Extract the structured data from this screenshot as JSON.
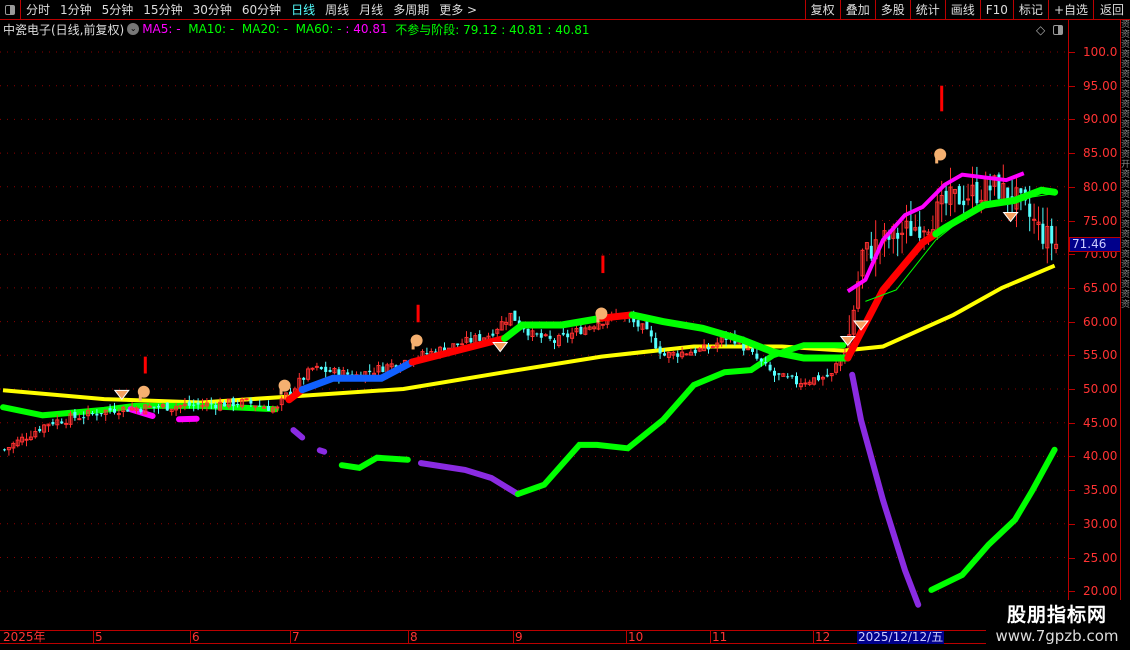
{
  "toolbar": {
    "periods": [
      "分时",
      "1分钟",
      "5分钟",
      "15分钟",
      "30分钟",
      "60分钟",
      "日线",
      "周线",
      "月线",
      "多周期",
      "更多 >"
    ],
    "active": "日线",
    "tools": [
      "复权",
      "叠加",
      "多股",
      "统计",
      "画线",
      "F10",
      "标记",
      "+自选"
    ],
    "back": "返回"
  },
  "legend": {
    "title": "中瓷电子(日线,前复权)",
    "ma5": "MA5: -",
    "ma10": "MA10: -",
    "ma20": "MA20: -",
    "ma60": "MA60: -",
    "ma_val": ": 40.81",
    "stage": "不参与阶段: 79.12 : 40.81 : 40.81"
  },
  "axis": {
    "ticks": [
      "100.0",
      "95.00",
      "90.00",
      "85.00",
      "80.00",
      "75.00",
      "70.00",
      "65.00",
      "60.00",
      "55.00",
      "50.00",
      "45.00",
      "40.00",
      "35.00",
      "30.00",
      "25.00",
      "20.00"
    ],
    "current_price": "71.46"
  },
  "dates": {
    "labels": [
      "2025年",
      "5",
      "6",
      "7",
      "8",
      "9",
      "10",
      "11",
      "12"
    ],
    "current": "2025/12/12/五"
  },
  "watermark": {
    "line1": "股朋指标网",
    "line2": "www.7gpzb.com"
  },
  "side_strip": "资资资资资资资资资资资资资资开资资资资资资资资资资资资资资",
  "colors": {
    "up": "#ff3030",
    "down": "#54ffff",
    "ma_yellow": "#ffff00",
    "green": "#00ff00",
    "purple": "#8a2be2",
    "magenta": "#ff00ff",
    "red": "#ff0000",
    "blue": "#1060ff"
  },
  "chart_data": {
    "type": "candlestick",
    "ylim": [
      17,
      103
    ],
    "days": 240,
    "close_path": [
      [
        0,
        41
      ],
      [
        10,
        45
      ],
      [
        25,
        47
      ],
      [
        40,
        47.5
      ],
      [
        55,
        48
      ],
      [
        62,
        47
      ],
      [
        64,
        49
      ],
      [
        70,
        53
      ],
      [
        80,
        52
      ],
      [
        90,
        54
      ],
      [
        100,
        56
      ],
      [
        110,
        58
      ],
      [
        115,
        61
      ],
      [
        120,
        58
      ],
      [
        125,
        57
      ],
      [
        135,
        60
      ],
      [
        140,
        61
      ],
      [
        145,
        59
      ],
      [
        150,
        55
      ],
      [
        160,
        56
      ],
      [
        165,
        58
      ],
      [
        170,
        55
      ],
      [
        175,
        52
      ],
      [
        180,
        51
      ],
      [
        188,
        52
      ],
      [
        192,
        58
      ],
      [
        195,
        70
      ],
      [
        200,
        72
      ],
      [
        210,
        75
      ],
      [
        215,
        78
      ],
      [
        225,
        80
      ],
      [
        230,
        78
      ],
      [
        236,
        73
      ],
      [
        239,
        71.46
      ]
    ],
    "yellow_ma": [
      [
        0,
        49.8
      ],
      [
        23,
        48.5
      ],
      [
        45,
        48.0
      ],
      [
        68,
        49.0
      ],
      [
        91,
        50.0
      ],
      [
        114,
        52.5
      ],
      [
        136,
        54.8
      ],
      [
        157,
        56.3
      ],
      [
        177,
        56.3
      ],
      [
        191,
        55.7
      ],
      [
        200,
        56.3
      ],
      [
        216,
        61.0
      ],
      [
        227,
        65.0
      ],
      [
        239,
        68.3
      ]
    ],
    "lower_segments": [
      {
        "c": "green",
        "p": [
          [
            0,
            47.3
          ],
          [
            9,
            46.1
          ],
          [
            23,
            46.9
          ],
          [
            30,
            47.5
          ],
          [
            45,
            47.5
          ],
          [
            62,
            47.0
          ]
        ]
      },
      {
        "c": "magenta",
        "p": [
          [
            29,
            47.0
          ],
          [
            34,
            46.0
          ]
        ]
      },
      {
        "c": "magenta",
        "p": [
          [
            40,
            45.5
          ],
          [
            44,
            45.6
          ]
        ]
      },
      {
        "c": "purple",
        "p": [
          [
            66,
            43.9
          ],
          [
            68,
            42.8
          ]
        ]
      },
      {
        "c": "purple",
        "p": [
          [
            72,
            40.9
          ],
          [
            73,
            40.7
          ]
        ]
      },
      {
        "c": "green",
        "p": [
          [
            77,
            38.7
          ],
          [
            81,
            38.3
          ],
          [
            85,
            39.8
          ],
          [
            92,
            39.5
          ]
        ]
      },
      {
        "c": "purple",
        "p": [
          [
            95,
            39.0
          ],
          [
            105,
            38.0
          ],
          [
            111,
            36.8
          ],
          [
            117,
            34.4
          ]
        ]
      },
      {
        "c": "green",
        "p": [
          [
            117,
            34.4
          ],
          [
            123,
            35.8
          ],
          [
            131,
            41.7
          ],
          [
            135,
            41.7
          ],
          [
            142,
            41.2
          ],
          [
            150,
            45.4
          ],
          [
            157,
            50.6
          ],
          [
            164,
            52.5
          ],
          [
            170,
            52.8
          ],
          [
            175,
            55.0
          ],
          [
            182,
            56.5
          ],
          [
            191,
            56.5
          ]
        ]
      },
      {
        "c": "purple",
        "p": [
          [
            193,
            52.1
          ],
          [
            195,
            45.4
          ],
          [
            200,
            33.5
          ],
          [
            205,
            23.1
          ],
          [
            208,
            18.0
          ]
        ]
      },
      {
        "c": "green",
        "p": [
          [
            211,
            20.2
          ],
          [
            218,
            22.4
          ],
          [
            224,
            26.9
          ],
          [
            230,
            30.6
          ],
          [
            234,
            35.0
          ],
          [
            239,
            41.0
          ]
        ]
      }
    ],
    "band_segments": [
      {
        "c": "red",
        "p": [
          [
            65,
            48.4
          ],
          [
            68,
            49.9
          ]
        ]
      },
      {
        "c": "blue",
        "p": [
          [
            68,
            49.9
          ],
          [
            75,
            51.6
          ],
          [
            86,
            51.6
          ],
          [
            93,
            54.0
          ]
        ]
      },
      {
        "c": "red",
        "p": [
          [
            93,
            54.0
          ],
          [
            102,
            55.5
          ],
          [
            114,
            57.5
          ]
        ]
      },
      {
        "c": "green",
        "p": [
          [
            114,
            57.5
          ],
          [
            118,
            59.5
          ],
          [
            127,
            59.5
          ],
          [
            136,
            60.5
          ]
        ]
      },
      {
        "c": "red",
        "p": [
          [
            136,
            60.5
          ],
          [
            143,
            61.0
          ]
        ]
      },
      {
        "c": "green",
        "p": [
          [
            143,
            61.0
          ],
          [
            150,
            60
          ],
          [
            159,
            59.0
          ],
          [
            168,
            57.3
          ],
          [
            175,
            55.5
          ],
          [
            182,
            54.6
          ],
          [
            192,
            54.6
          ]
        ]
      },
      {
        "c": "red",
        "p": [
          [
            192,
            54.6
          ],
          [
            200,
            64.7
          ],
          [
            209,
            71.7
          ],
          [
            212,
            73
          ]
        ]
      },
      {
        "c": "green",
        "p": [
          [
            212,
            73
          ],
          [
            214,
            73.9
          ],
          [
            223,
            77.3
          ],
          [
            230,
            78.0
          ],
          [
            236,
            79.5
          ],
          [
            239,
            79.2
          ]
        ]
      }
    ],
    "magenta_upper": [
      [
        192,
        64.5
      ],
      [
        196,
        66.2
      ],
      [
        200,
        72.1
      ],
      [
        205,
        75.8
      ],
      [
        209,
        77
      ],
      [
        214,
        80.3
      ],
      [
        218,
        81.8
      ],
      [
        228,
        81
      ],
      [
        232,
        82
      ]
    ],
    "thin_green": [
      [
        196,
        63
      ],
      [
        203,
        64.7
      ],
      [
        212,
        72.1
      ],
      [
        222,
        77.3
      ],
      [
        239,
        79
      ]
    ],
    "red_markers": [
      [
        32,
        54.8,
        52.3
      ],
      [
        94,
        62.5,
        59.9
      ],
      [
        136,
        69.8,
        67.2
      ],
      [
        213,
        95,
        91.2
      ]
    ],
    "diamonds": [
      [
        27,
        49.2
      ],
      [
        113,
        56.3
      ],
      [
        192,
        57.2
      ],
      [
        195,
        59.5
      ],
      [
        229,
        75.6
      ]
    ],
    "hands": [
      [
        32,
        49.6
      ],
      [
        64,
        50.5
      ],
      [
        94,
        57.2
      ],
      [
        136,
        61.2
      ],
      [
        213,
        84.8
      ]
    ]
  }
}
